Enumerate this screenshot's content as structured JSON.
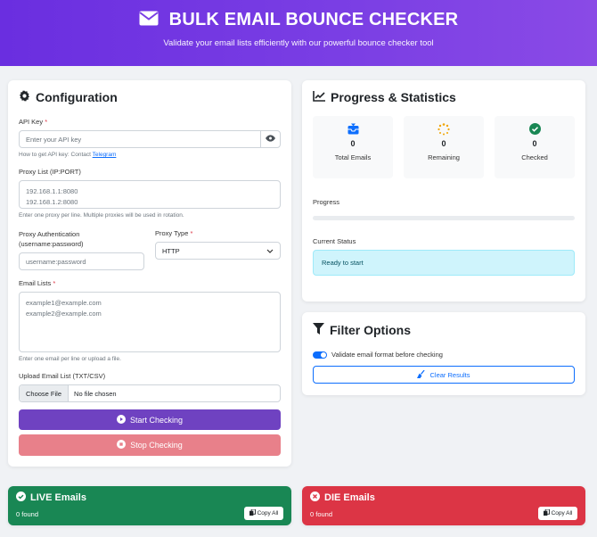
{
  "header": {
    "title": "BULK EMAIL BOUNCE CHECKER",
    "subtitle": "Validate your email lists efficiently with our powerful bounce checker tool"
  },
  "config": {
    "title": "Configuration",
    "api_key_label": "API Key",
    "required_mark": "*",
    "api_key_placeholder": "Enter your API key",
    "api_hint": "How to get API key: Contact",
    "api_hint_link": "Telegram",
    "proxy_list_label": "Proxy List (IP:PORT)",
    "proxy_list_placeholder": "192.168.1.1:8080\n192.168.1.2:8080",
    "proxy_list_hint": "Enter one proxy per line. Multiple proxies will be used in rotation.",
    "proxy_auth_label": "Proxy Authentication (username:password)",
    "proxy_auth_placeholder": "username:password",
    "proxy_type_label": "Proxy Type",
    "proxy_type_value": "HTTP",
    "email_lists_label": "Email Lists",
    "email_lists_placeholder": "example1@example.com\nexample2@example.com",
    "email_lists_hint": "Enter one email per line or upload a file.",
    "upload_label": "Upload Email List (TXT/CSV)",
    "choose_file": "Choose File",
    "no_file": "No file chosen",
    "start_button": "Start Checking",
    "stop_button": "Stop Checking"
  },
  "progress": {
    "title": "Progress & Statistics",
    "stats": [
      {
        "value": "0",
        "label": "Total Emails"
      },
      {
        "value": "0",
        "label": "Remaining"
      },
      {
        "value": "0",
        "label": "Checked"
      }
    ],
    "progress_label": "Progress",
    "progress_fraction": 0,
    "status_label": "Current Status",
    "status_text": "Ready to start"
  },
  "filter": {
    "title": "Filter Options",
    "validate_toggle_label": "Validate email format before checking",
    "validate_toggle_on": true,
    "clear_button": "Clear Results"
  },
  "live": {
    "title": "LIVE Emails",
    "count": "0 found",
    "copy": "Copy All"
  },
  "die": {
    "title": "DIE Emails",
    "count": "0 found",
    "copy": "Copy All"
  },
  "colors": {
    "header_start": "#6a2ee0",
    "primary_purple": "#6f42c1",
    "stop_pink": "#e8808a",
    "live_green": "#198754",
    "die_red": "#dc3545",
    "status_bg": "#cff4fc",
    "link_blue": "#0d6efd"
  }
}
